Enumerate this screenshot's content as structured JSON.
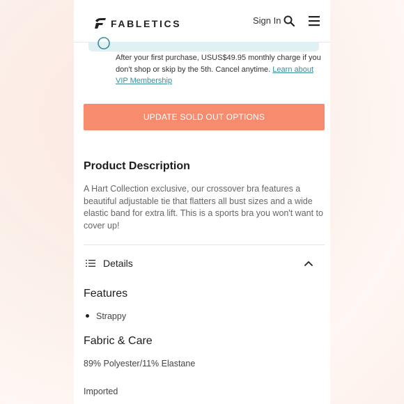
{
  "header": {
    "brand": "FABLETICS",
    "sign_in": "Sign In",
    "search_icon": "search-icon",
    "menu_icon": "hamburger-menu-icon"
  },
  "membership": {
    "text": "After your first purchase, USUS$49.95 monthly charge if you don't shop or skip by the 5th. Cancel anytime.",
    "link": "Learn about VIP Membership"
  },
  "actions": {
    "update_button": "UPDATE SOLD OUT OPTIONS",
    "button_color": "#f68b6e"
  },
  "description": {
    "title": "Product Description",
    "body": "A Hart Collection exclusive, our crossover bra features a beautiful adjustable tie that flatters all bust sizes and a wide elastic band for extra lift. This is a sports bra you won't want to cover up!"
  },
  "details": {
    "label": "Details",
    "expanded": true,
    "features_title": "Features",
    "features": [
      "Strappy"
    ],
    "fabric_title": "Fabric & Care",
    "fabric": "89% Polyester/11% Elastane",
    "origin": "Imported"
  }
}
